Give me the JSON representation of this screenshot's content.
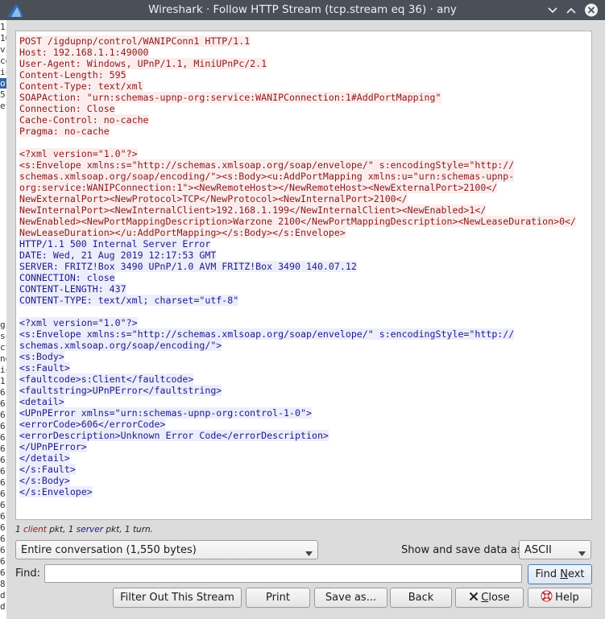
{
  "window": {
    "title": "Wireshark · Follow HTTP Stream (tcp.stream eq 36) · any",
    "icons": [
      "wireshark-fin-icon",
      "minimize-icon",
      "maximize-icon",
      "close-icon"
    ]
  },
  "behind": {
    "fragments": [
      "1",
      "16",
      "vi",
      "co",
      "ic",
      "ot",
      "5",
      "et",
      "gi",
      "sc",
      "ct",
      "ne",
      "ic",
      "1",
      "6",
      "6",
      "6",
      "6",
      "6",
      "6",
      "6",
      "6",
      "6",
      "6",
      "6",
      "6",
      "6",
      "6",
      "6",
      "6",
      "6",
      "8",
      "d",
      "d"
    ]
  },
  "stream": {
    "lines": [
      {
        "dir": "client",
        "text": "POST /igdupnp/control/WANIPConn1 HTTP/1.1"
      },
      {
        "dir": "client",
        "text": "Host: 192.168.1.1:49000"
      },
      {
        "dir": "client",
        "text": "User-Agent: Windows, UPnP/1.1, MiniUPnPc/2.1"
      },
      {
        "dir": "client",
        "text": "Content-Length: 595"
      },
      {
        "dir": "client",
        "text": "Content-Type: text/xml"
      },
      {
        "dir": "client",
        "text": "SOAPAction: \"urn:schemas-upnp-org:service:WANIPConnection:1#AddPortMapping\""
      },
      {
        "dir": "client",
        "text": "Connection: Close"
      },
      {
        "dir": "client",
        "text": "Cache-Control: no-cache"
      },
      {
        "dir": "client",
        "text": "Pragma: no-cache"
      },
      {
        "dir": "client",
        "text": ""
      },
      {
        "dir": "client",
        "text": "<?xml version=\"1.0\"?>"
      },
      {
        "dir": "client",
        "text": "<s:Envelope xmlns:s=\"http://schemas.xmlsoap.org/soap/envelope/\" s:encodingStyle=\"http://"
      },
      {
        "dir": "client",
        "text": "schemas.xmlsoap.org/soap/encoding/\"><s:Body><u:AddPortMapping xmlns:u=\"urn:schemas-upnp-"
      },
      {
        "dir": "client",
        "text": "org:service:WANIPConnection:1\"><NewRemoteHost></NewRemoteHost><NewExternalPort>2100</"
      },
      {
        "dir": "client",
        "text": "NewExternalPort><NewProtocol>TCP</NewProtocol><NewInternalPort>2100</"
      },
      {
        "dir": "client",
        "text": "NewInternalPort><NewInternalClient>192.168.1.199</NewInternalClient><NewEnabled>1</"
      },
      {
        "dir": "client",
        "text": "NewEnabled><NewPortMappingDescription>Warzone 2100</NewPortMappingDescription><NewLeaseDuration>0</"
      },
      {
        "dir": "client",
        "text": "NewLeaseDuration></u:AddPortMapping></s:Body></s:Envelope>"
      },
      {
        "dir": "server",
        "text": "HTTP/1.1 500 Internal Server Error"
      },
      {
        "dir": "server",
        "text": "DATE: Wed, 21 Aug 2019 12:17:53 GMT"
      },
      {
        "dir": "server",
        "text": "SERVER: FRITZ!Box 3490 UPnP/1.0 AVM FRITZ!Box 3490 140.07.12"
      },
      {
        "dir": "server",
        "text": "CONNECTION: close"
      },
      {
        "dir": "server",
        "text": "CONTENT-LENGTH: 437"
      },
      {
        "dir": "server",
        "text": "CONTENT-TYPE: text/xml; charset=\"utf-8\""
      },
      {
        "dir": "server",
        "text": ""
      },
      {
        "dir": "server",
        "text": "<?xml version=\"1.0\"?>"
      },
      {
        "dir": "server",
        "text": "<s:Envelope xmlns:s=\"http://schemas.xmlsoap.org/soap/envelope/\" s:encodingStyle=\"http://"
      },
      {
        "dir": "server",
        "text": "schemas.xmlsoap.org/soap/encoding/\">"
      },
      {
        "dir": "server",
        "text": "<s:Body>"
      },
      {
        "dir": "server",
        "text": "<s:Fault>"
      },
      {
        "dir": "server",
        "text": "<faultcode>s:Client</faultcode>"
      },
      {
        "dir": "server",
        "text": "<faultstring>UPnPError</faultstring>"
      },
      {
        "dir": "server",
        "text": "<detail>"
      },
      {
        "dir": "server",
        "text": "<UPnPError xmlns=\"urn:schemas-upnp-org:control-1-0\">"
      },
      {
        "dir": "server",
        "text": "<errorCode>606</errorCode>"
      },
      {
        "dir": "server",
        "text": "<errorDescription>Unknown Error Code</errorDescription>"
      },
      {
        "dir": "server",
        "text": "</UPnPError>"
      },
      {
        "dir": "server",
        "text": "</detail>"
      },
      {
        "dir": "server",
        "text": "</s:Fault>"
      },
      {
        "dir": "server",
        "text": "</s:Body>"
      },
      {
        "dir": "server",
        "text": "</s:Envelope>"
      }
    ]
  },
  "stats": {
    "count_client": "1",
    "client_word": "client",
    "mid_text": " pkt, ",
    "count_server": "1",
    "server_word": "server",
    "end_text": " pkt, 1 turn."
  },
  "controls": {
    "conversation_selected": "Entire conversation (1,550 bytes)",
    "show_save_label": "Show and save data as",
    "data_format_selected": "ASCII",
    "find_label": "Find:",
    "find_value": "",
    "find_next_prefix": "Find ",
    "find_next_accel": "N",
    "find_next_suffix": "ext"
  },
  "buttons": {
    "filter_out": "Filter Out This Stream",
    "print": "Print",
    "save_as": "Save as...",
    "back": "Back",
    "close": "Close",
    "close_accel": "C",
    "close_rest": "lose",
    "help": "Help"
  },
  "colors": {
    "client_text": "#8b1a1a",
    "client_bg": "#fbeded",
    "server_text": "#1a1a8c",
    "server_bg": "#ededfb",
    "titlebar": "#4a5058"
  }
}
